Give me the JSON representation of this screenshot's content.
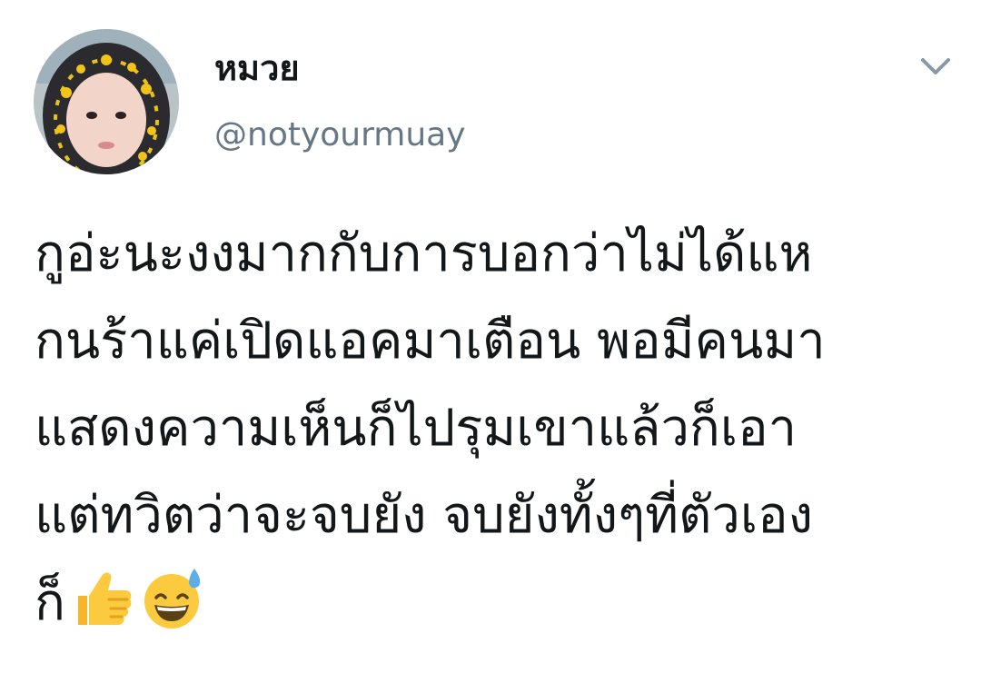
{
  "tweet": {
    "author": {
      "display_name": "หมวย",
      "handle": "@notyourmuay",
      "avatar_icon": "profile-photo"
    },
    "menu_icon": "chevron-down-icon",
    "text_lines": [
      "กูอ่ะนะงงมากกับการบอกว่าไม่ได้แห",
      "กนร้าแค่เปิดแอคมาเตือน พอมีคนมา",
      "แสดงความเห็นก็ไปรุมเขาแล้วก็เอา",
      "แต่ทวิตว่าจะจบยัง จบยังทั้งๆที่ตัวเอง",
      "ก็"
    ],
    "emojis": [
      "thumbs-up-icon",
      "grinning-sweat-icon"
    ],
    "colors": {
      "text": "#14171a",
      "secondary": "#657786",
      "chevron": "#8899a6"
    }
  }
}
